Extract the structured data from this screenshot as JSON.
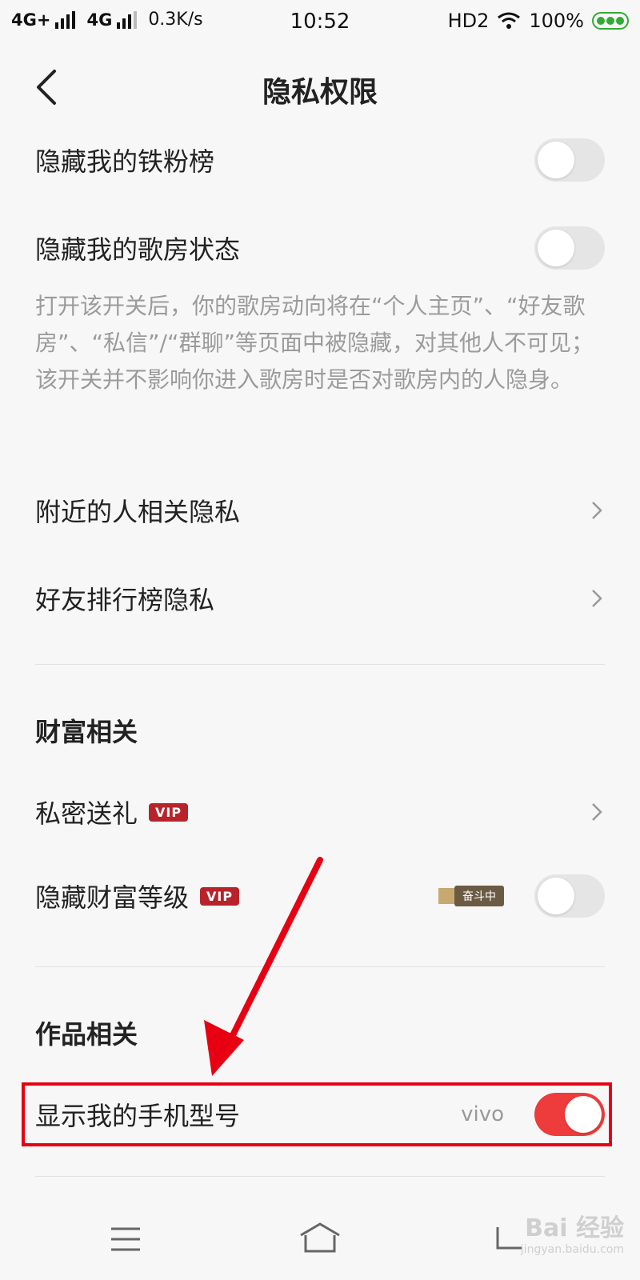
{
  "status_bar": {
    "network1": "4G+",
    "network2": "4G",
    "speed": "0.3K/s",
    "time": "10:52",
    "hd": "HD2",
    "battery": "100%"
  },
  "header": {
    "title": "隐私权限"
  },
  "rows": {
    "hide_fans": {
      "label": "隐藏我的铁粉榜",
      "on": false
    },
    "hide_room": {
      "label": "隐藏我的歌房状态",
      "on": false
    },
    "room_description": "打开该开关后，你的歌房动向将在“个人主页”、“好友歌房”、“私信”/“群聊”等页面中被隐藏，对其他人不可见；该开关并不影响你进入歌房时是否对歌房内的人隐身。",
    "nearby": {
      "label": "附近的人相关隐私"
    },
    "friends_rank": {
      "label": "好友排行榜隐私"
    }
  },
  "wealth": {
    "section_title": "财富相关",
    "private_gift": {
      "label": "私密送礼",
      "badge": "VIP"
    },
    "hide_wealth": {
      "label": "隐藏财富等级",
      "badge": "VIP",
      "status_tag": "奋斗中",
      "on": false
    }
  },
  "works": {
    "section_title": "作品相关",
    "show_model": {
      "label": "显示我的手机型号",
      "value": "vivo",
      "on": true
    }
  },
  "watermark": {
    "text": "Bai 经验",
    "sub": "jingyan.baidu.com"
  },
  "colors": {
    "accent": "#ee3b3b",
    "highlight": "#e60012",
    "vip": "#b8232b"
  }
}
